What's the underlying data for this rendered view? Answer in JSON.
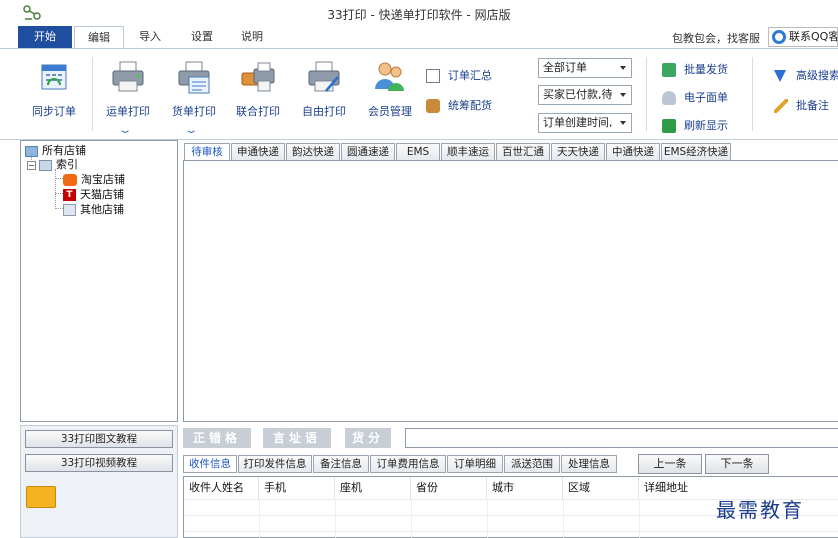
{
  "window": {
    "title": "33打印 - 快递单打印软件 - 网店版"
  },
  "ribbon_tabs": [
    "开始",
    "编辑",
    "导入",
    "设置",
    "说明"
  ],
  "header_right": {
    "help_text": "包教包会，找客服",
    "qq_label": "联系QQ客服"
  },
  "ribbon": {
    "large_buttons": {
      "sync": "同步订单",
      "waybill": "运单打印",
      "invoice": "货单打印",
      "combined": "联合打印",
      "free": "自由打印",
      "member": "会员管理"
    },
    "mid_buttons": {
      "summary": "订单汇总",
      "allocate": "统筹配货"
    },
    "dropdowns": {
      "orders": "全部订单",
      "payment": "买家已付款,待",
      "sort": "订单创建时间,"
    },
    "right_buttons": {
      "batch_ship": "批量发货",
      "e_waybill": "电子面单",
      "refresh": "刷新显示"
    },
    "far_buttons": {
      "adv_search": "高级搜索",
      "batch_note": "批备注"
    }
  },
  "shop_tree": {
    "root": "所有店铺",
    "group": "索引",
    "shops": [
      "淘宝店铺",
      "天猫店铺",
      "其他店铺"
    ]
  },
  "tutorials": {
    "text_tutorial": "33打印图文教程",
    "video_tutorial": "33打印视频教程"
  },
  "carrier_tabs": [
    "待审核",
    "申通快递",
    "韵达快递",
    "圆通速递",
    "EMS",
    "顺丰速运",
    "百世汇通",
    "天天快递",
    "中通快递",
    "EMS经济快递"
  ],
  "status_ghosts": [
    "正",
    "错",
    "格",
    "言",
    "址",
    "语",
    "货",
    "分"
  ],
  "info_tabs": [
    "收件信息",
    "打印发件信息",
    "备注信息",
    "订单费用信息",
    "订单明细",
    "派送范围",
    "处理信息"
  ],
  "nav": {
    "prev": "上一条",
    "next": "下一条"
  },
  "grid_columns": [
    "收件人姓名",
    "手机",
    "座机",
    "省份",
    "城市",
    "区域",
    "详细地址"
  ],
  "watermark": "最需教育"
}
